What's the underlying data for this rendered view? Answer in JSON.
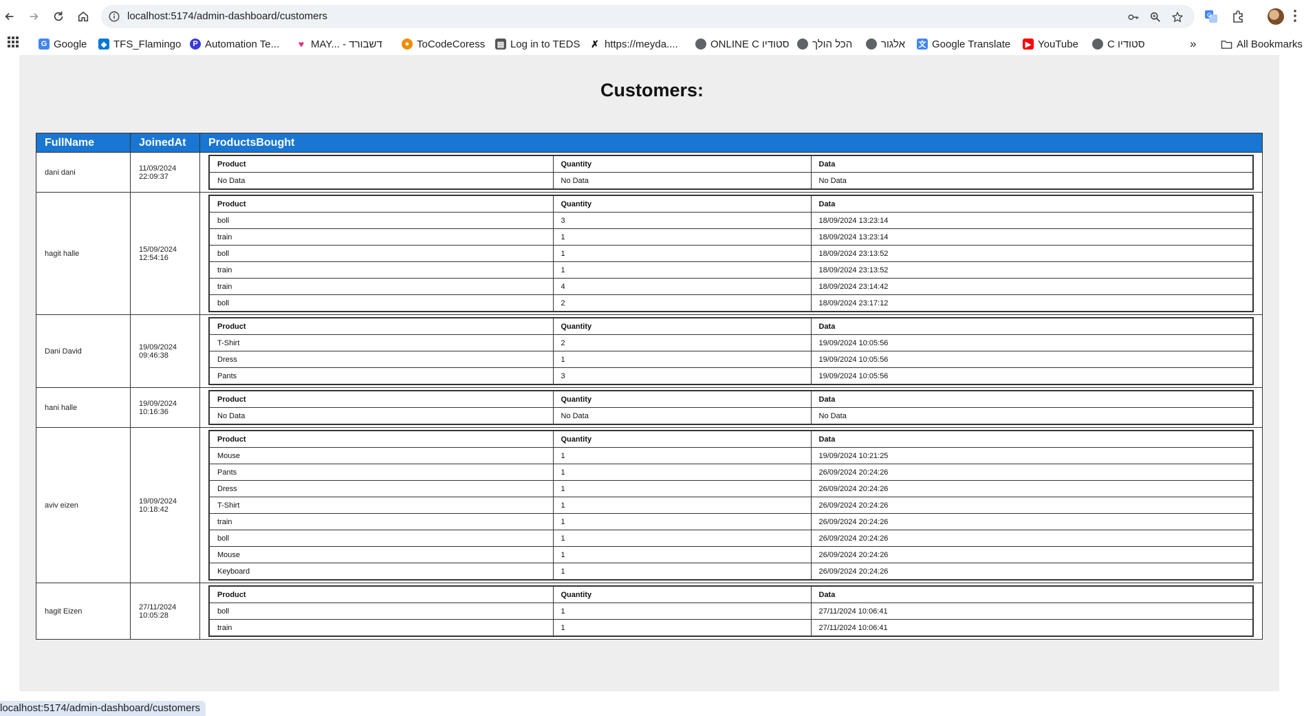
{
  "browser": {
    "url": "localhost:5174/admin-dashboard/customers",
    "status_url": "localhost:5174/admin-dashboard/customers",
    "bookmarks": [
      {
        "label": "Google",
        "icon": "google-icon",
        "color": "#4285f4"
      },
      {
        "label": "TFS_Flamingo",
        "icon": "azure-devops-icon",
        "color": "#0078d4"
      },
      {
        "label": "Automation Te...",
        "icon": "p-icon",
        "color": "#3b3bd9"
      },
      {
        "label": "MAY... - דשבורד",
        "icon": "heart-icon",
        "color": "#d6338a"
      },
      {
        "label": "ToCodeCoress",
        "icon": "tocode-icon",
        "color": "#f08c00"
      },
      {
        "label": "Log in to TEDS",
        "icon": "teds-icon",
        "color": "#555555"
      },
      {
        "label": "https://meyda....",
        "icon": "meyda-icon",
        "color": "#111111"
      },
      {
        "label": "ONLINE C סטודיו",
        "icon": "globe-icon",
        "color": "#5f6368"
      },
      {
        "label": "הכל הולך",
        "icon": "globe-icon",
        "color": "#5f6368"
      },
      {
        "label": "אלגור",
        "icon": "globe-icon",
        "color": "#5f6368"
      },
      {
        "label": "Google Translate",
        "icon": "translate-icon",
        "color": "#4285f4"
      },
      {
        "label": "YouTube",
        "icon": "youtube-icon",
        "color": "#ff0000"
      },
      {
        "label": "C סטודיו",
        "icon": "globe-icon",
        "color": "#5f6368"
      }
    ],
    "all_bookmarks_label": "All Bookmarks"
  },
  "page": {
    "title": "Customers:",
    "columns": [
      "FullName",
      "JoinedAt",
      "ProductsBought"
    ],
    "inner_columns": [
      "Product",
      "Quantity",
      "Data"
    ],
    "accent_color": "#1976d2"
  },
  "customers": [
    {
      "name": "dani dani",
      "joined_date": "11/09/2024",
      "joined_time": "22:09:37",
      "products": [
        {
          "product": "No Data",
          "quantity": "No Data",
          "date": "No Data"
        }
      ]
    },
    {
      "name": "hagit halle",
      "joined_date": "15/09/2024",
      "joined_time": "12:54:16",
      "products": [
        {
          "product": "boll",
          "quantity": "3",
          "date": "18/09/2024 13:23:14"
        },
        {
          "product": "train",
          "quantity": "1",
          "date": "18/09/2024 13:23:14"
        },
        {
          "product": "boll",
          "quantity": "1",
          "date": "18/09/2024 23:13:52"
        },
        {
          "product": "train",
          "quantity": "1",
          "date": "18/09/2024 23:13:52"
        },
        {
          "product": "train",
          "quantity": "4",
          "date": "18/09/2024 23:14:42"
        },
        {
          "product": "boll",
          "quantity": "2",
          "date": "18/09/2024 23:17:12"
        }
      ]
    },
    {
      "name": "Dani David",
      "joined_date": "19/09/2024",
      "joined_time": "09:46:38",
      "products": [
        {
          "product": "T-Shirt",
          "quantity": "2",
          "date": "19/09/2024 10:05:56"
        },
        {
          "product": "Dress",
          "quantity": "1",
          "date": "19/09/2024 10:05:56"
        },
        {
          "product": "Pants",
          "quantity": "3",
          "date": "19/09/2024 10:05:56"
        }
      ]
    },
    {
      "name": "hani halle",
      "joined_date": "19/09/2024",
      "joined_time": "10:16:36",
      "products": [
        {
          "product": "No Data",
          "quantity": "No Data",
          "date": "No Data"
        }
      ]
    },
    {
      "name": "aviv eizen",
      "joined_date": "19/09/2024",
      "joined_time": "10:18:42",
      "products": [
        {
          "product": "Mouse",
          "quantity": "1",
          "date": "19/09/2024 10:21:25"
        },
        {
          "product": "Pants",
          "quantity": "1",
          "date": "26/09/2024 20:24:26"
        },
        {
          "product": "Dress",
          "quantity": "1",
          "date": "26/09/2024 20:24:26"
        },
        {
          "product": "T-Shirt",
          "quantity": "1",
          "date": "26/09/2024 20:24:26"
        },
        {
          "product": "train",
          "quantity": "1",
          "date": "26/09/2024 20:24:26"
        },
        {
          "product": "boll",
          "quantity": "1",
          "date": "26/09/2024 20:24:26"
        },
        {
          "product": "Mouse",
          "quantity": "1",
          "date": "26/09/2024 20:24:26"
        },
        {
          "product": "Keyboard",
          "quantity": "1",
          "date": "26/09/2024 20:24:26"
        }
      ]
    },
    {
      "name": "hagit Eizen",
      "joined_date": "27/11/2024",
      "joined_time": "10:05:28",
      "products": [
        {
          "product": "boll",
          "quantity": "1",
          "date": "27/11/2024 10:06:41"
        },
        {
          "product": "train",
          "quantity": "1",
          "date": "27/11/2024 10:06:41"
        }
      ]
    }
  ]
}
